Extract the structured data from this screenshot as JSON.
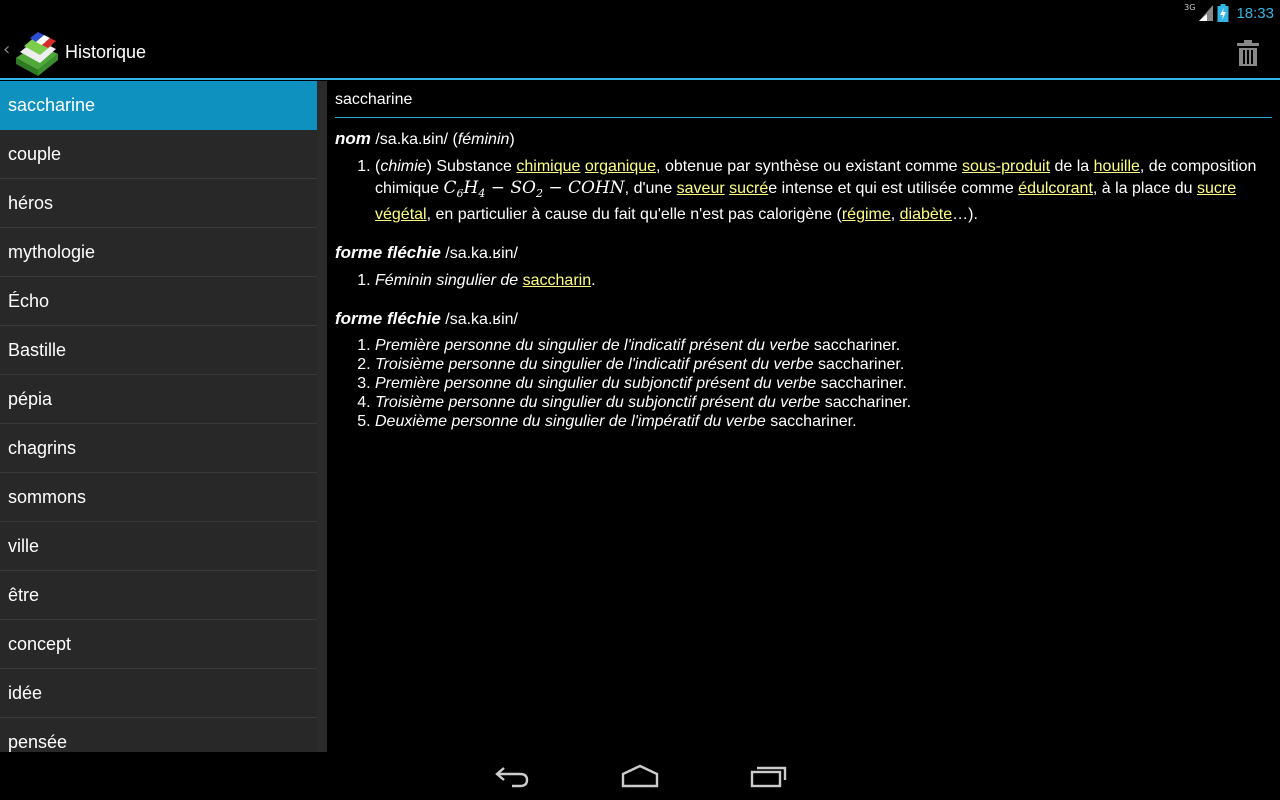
{
  "status": {
    "time": "18:33",
    "network": "3G",
    "icons": [
      "signal-icon",
      "battery-charging-icon"
    ]
  },
  "actionbar": {
    "title": "Historique",
    "icons": [
      "up-caret-icon",
      "dictionary-book-icon",
      "trash-icon"
    ]
  },
  "history": {
    "items": [
      "saccharine",
      "couple",
      "héros",
      "mythologie",
      "Écho",
      "Bastille",
      "pépia",
      "chagrins",
      "sommons",
      "ville",
      "être",
      "concept",
      "idée",
      "pensée"
    ],
    "selected_index": 0
  },
  "definition": {
    "headword": "saccharine",
    "s1": {
      "pos": "nom",
      "pron": "/sa.ka.ʁin/",
      "gender_open": "(",
      "gender": "féminin",
      "gender_close": ")",
      "d1": {
        "domain": "chimie",
        "t1": " Substance ",
        "l1": "chimique",
        "l2": "organique",
        "t2": ", obtenue par synthèse ou existant comme ",
        "l3": "sous-produit",
        "t3": " de la ",
        "l4": "houille",
        "t4": ", de composition chimique ",
        "formula": {
          "c": "C",
          "c_sub": "6",
          "h": "H",
          "h_sub": "4",
          "mid": " − SO",
          "o_sub": "2",
          "end": " − COHN"
        },
        "t5": ", d'une ",
        "l5": "saveur",
        "l6": "sucré",
        "t6": "e intense et qui est utilisée comme ",
        "l7": "édulcorant",
        "t7": ", à la place du ",
        "l8": "sucre végétal",
        "t8": ", en particulier à cause du fait qu'elle n'est pas calorigène (",
        "l9": "régime",
        "l10": "diabète",
        "t9": "…)."
      }
    },
    "s2": {
      "pos": "forme fléchie",
      "pron": "/sa.ka.ʁin/",
      "d1": {
        "text": "Féminin singulier de ",
        "link": "saccharin"
      }
    },
    "s3": {
      "pos": "forme fléchie",
      "pron": "/sa.ka.ʁin/",
      "defs": [
        {
          "italic": "Première personne du singulier de l'indicatif présent du verbe",
          "word": " sacchariner."
        },
        {
          "italic": "Troisième personne du singulier de l'indicatif présent du verbe",
          "word": " sacchariner."
        },
        {
          "italic": "Première personne du singulier du subjonctif présent du verbe",
          "word": " sacchariner."
        },
        {
          "italic": "Troisième personne du singulier du subjonctif présent du verbe",
          "word": " sacchariner."
        },
        {
          "italic": "Deuxième personne du singulier de l'impératif du verbe",
          "word": " sacchariner."
        }
      ]
    }
  },
  "navbar": {
    "icons": [
      "back-icon",
      "home-icon",
      "recent-apps-icon"
    ]
  },
  "colors": {
    "accent": "#33b5e5",
    "selected": "#0f91c0",
    "link": "#ffff7f",
    "list_bg": "#282828"
  }
}
